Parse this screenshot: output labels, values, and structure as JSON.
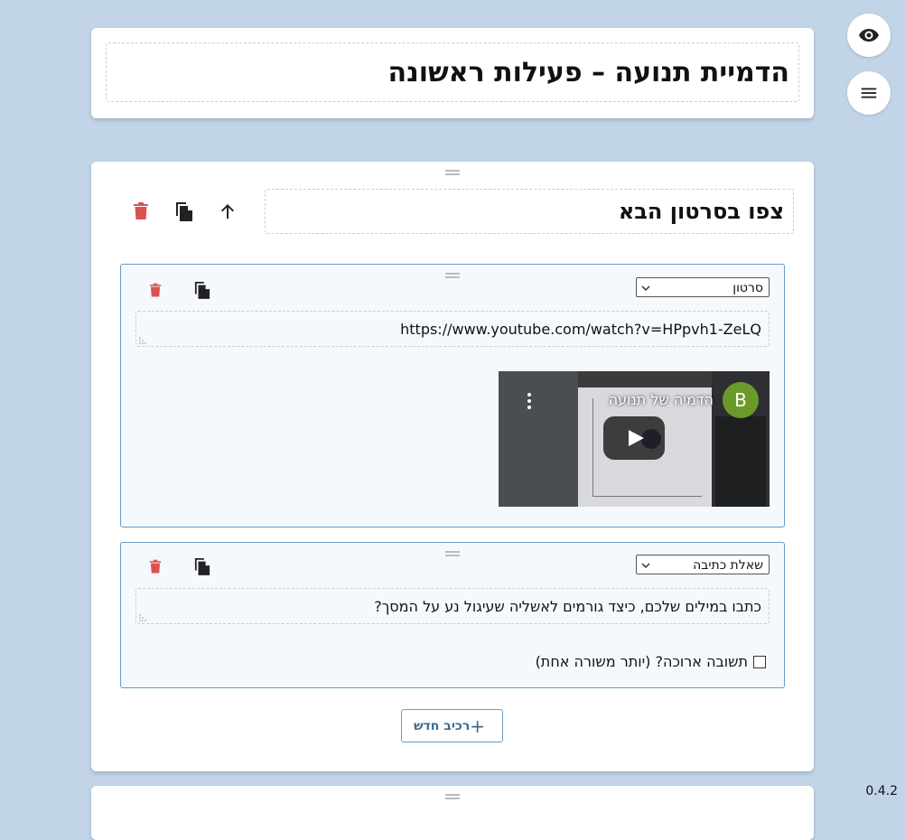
{
  "page": {
    "title": "הדמיית תנועה – פעילות ראשונה",
    "version": "0.4.2"
  },
  "section": {
    "title": "צפו בסרטון הבא",
    "new_component_label": "רכיב חדש"
  },
  "components": [
    {
      "type_label": "סרטון",
      "value": "https://www.youtube.com/watch?v=HPpvh1-ZeLQ",
      "video": {
        "title": "הדמיה של תנועה",
        "avatar_letter": "B"
      }
    },
    {
      "type_label": "שאלת כתיבה",
      "value": "כתבו במילים שלכם, כיצד גורמים לאשליה שעיגול נע על המסך?",
      "checkbox_label": "תשובה ארוכה? (יותר משורה אחת)"
    }
  ],
  "colors": {
    "background": "#c2d4e8",
    "delete": "#d9534f",
    "accent": "#6a9cc4",
    "component_bg": "#f5f9fd"
  },
  "icons": {
    "preview": "eye-icon",
    "menu": "hamburger-icon",
    "delete": "trash-icon",
    "duplicate": "copy-icon",
    "move_up": "arrow-up-icon"
  }
}
